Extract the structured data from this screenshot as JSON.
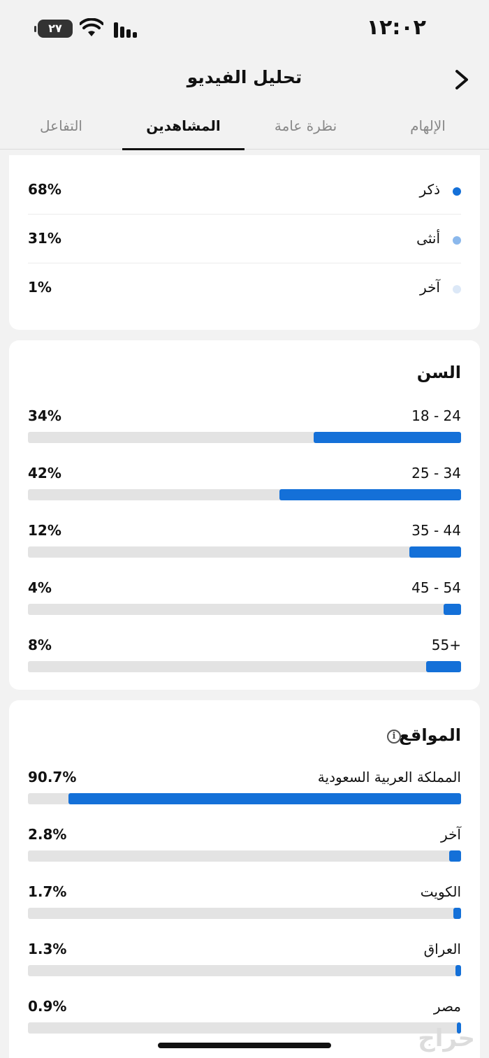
{
  "status_bar": {
    "time": "١٢:٠٢",
    "battery": "٢٧"
  },
  "header": {
    "title": "تحليل الفيديو"
  },
  "tabs": [
    {
      "label": "الإلهام",
      "active": false
    },
    {
      "label": "نظرة عامة",
      "active": false
    },
    {
      "label": "المشاهدين",
      "active": true
    },
    {
      "label": "التفاعل",
      "active": false
    }
  ],
  "gender": [
    {
      "label": "ذكر",
      "percent": "68%",
      "color": "#1470d8"
    },
    {
      "label": "أنثى",
      "percent": "31%",
      "color": "#8bb8ec"
    },
    {
      "label": "آخر",
      "percent": "1%",
      "color": "#dce8f7"
    }
  ],
  "age": {
    "title": "السن",
    "rows": [
      {
        "label": "18 - 24",
        "percent": "34%",
        "value": 34
      },
      {
        "label": "25 - 34",
        "percent": "42%",
        "value": 42
      },
      {
        "label": "35 - 44",
        "percent": "12%",
        "value": 12
      },
      {
        "label": "45 - 54",
        "percent": "4%",
        "value": 4
      },
      {
        "label": "55+",
        "percent": "8%",
        "value": 8
      }
    ]
  },
  "locations": {
    "title": "المواقع",
    "rows": [
      {
        "label": "المملكة العربية السعودية",
        "percent": "90.7%",
        "value": 90.7
      },
      {
        "label": "آخر",
        "percent": "2.8%",
        "value": 2.8
      },
      {
        "label": "الكويت",
        "percent": "1.7%",
        "value": 1.7
      },
      {
        "label": "العراق",
        "percent": "1.3%",
        "value": 1.3
      },
      {
        "label": "مصر",
        "percent": "0.9%",
        "value": 0.9
      }
    ]
  },
  "colors": {
    "accent": "#1470d8",
    "track": "#e3e3e3"
  },
  "watermark": "حراج"
}
